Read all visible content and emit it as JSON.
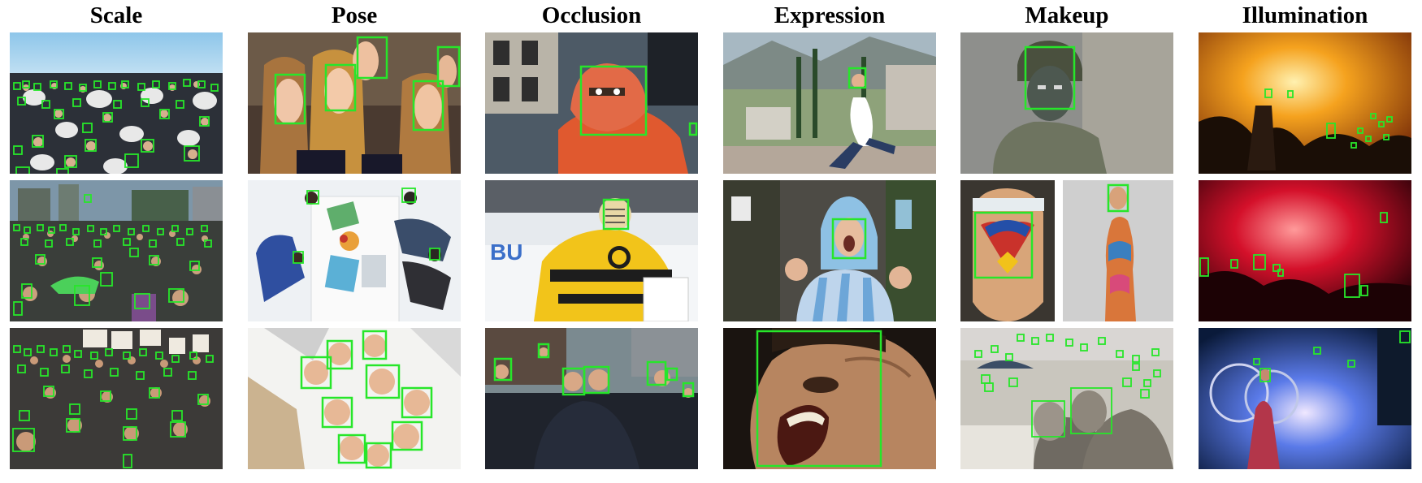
{
  "figure": {
    "columns": [
      {
        "id": "scale",
        "title": "Scale"
      },
      {
        "id": "pose",
        "title": "Pose"
      },
      {
        "id": "occlusion",
        "title": "Occlusion"
      },
      {
        "id": "expression",
        "title": "Expression"
      },
      {
        "id": "makeup",
        "title": "Makeup"
      },
      {
        "id": "illumination",
        "title": "Illumination"
      }
    ]
  },
  "overlays": {
    "face_box_color": "#27e62a"
  },
  "photo_descriptions": {
    "scale": [
      "marching band crowd under blue sky",
      "dense street crowd in city",
      "protest crowd with signs"
    ],
    "pose": [
      "cheerleaders in profile",
      "top-down view of people at desk",
      "circle of faces looking down at camera"
    ],
    "occlusion": [
      "person with orange face covering",
      "hockey goalie in mask",
      "crowd embracing in street"
    ],
    "expression": [
      "woman jumping joyfully",
      "fan shouting in striped jersey",
      "close-up of screaming face"
    ],
    "makeup": [
      "soldier with face paint",
      "painted faces side by side",
      "crowd covered in mud"
    ],
    "illumination": [
      "concert stage with fire",
      "crowd in red smoke",
      "performer with stage lights"
    ]
  }
}
